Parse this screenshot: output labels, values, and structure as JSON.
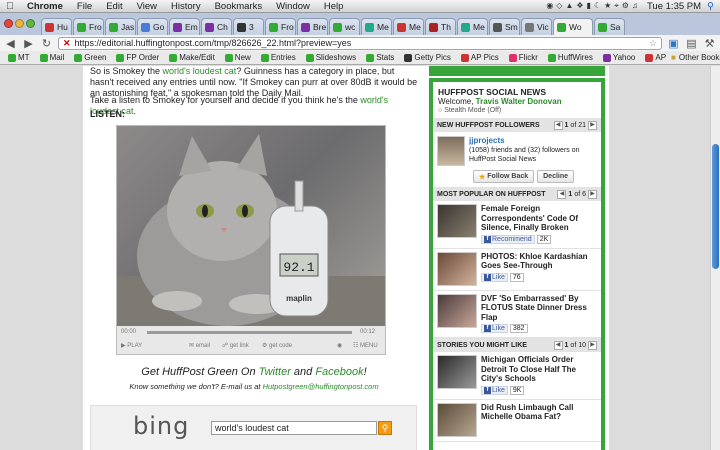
{
  "menubar": {
    "app": "Chrome",
    "items": [
      "File",
      "Edit",
      "View",
      "History",
      "Bookmarks",
      "Window",
      "Help"
    ],
    "clock": "Tue 1:35 PM"
  },
  "tabs": [
    {
      "label": "Hu",
      "icon": "gmail-icon",
      "color": "#c33"
    },
    {
      "label": "Fro",
      "icon": "green-h-icon",
      "color": "#3a3"
    },
    {
      "label": "Jas",
      "icon": "green-h-icon",
      "color": "#3a3"
    },
    {
      "label": "Go",
      "icon": "google-icon",
      "color": "#4a7cd6"
    },
    {
      "label": "Em",
      "icon": "yahoo-icon",
      "color": "#7b2fa2"
    },
    {
      "label": "Ch",
      "icon": "yahoo-icon",
      "color": "#7b2fa2"
    },
    {
      "label": "3",
      "icon": "number-icon",
      "color": "#333"
    },
    {
      "label": "Fro",
      "icon": "green-h-icon",
      "color": "#3a3"
    },
    {
      "label": "Bre",
      "icon": "yahoo-icon",
      "color": "#7b2fa2"
    },
    {
      "label": "wc",
      "icon": "green-h-icon",
      "color": "#3a3"
    },
    {
      "label": "Me",
      "icon": "green-page-icon",
      "color": "#2a8"
    },
    {
      "label": "Me",
      "icon": "red-page-icon",
      "color": "#c33"
    },
    {
      "label": "Th",
      "icon": "red-page-icon",
      "color": "#a22"
    },
    {
      "label": "Me",
      "icon": "green-page-icon",
      "color": "#2a8"
    },
    {
      "label": "Sm",
      "icon": "globe-icon",
      "color": "#555"
    },
    {
      "label": "Vic",
      "icon": "clock-icon",
      "color": "#777"
    },
    {
      "label": "Wo",
      "icon": "green-h-icon",
      "color": "#3a3",
      "active": true
    },
    {
      "label": "Sa",
      "icon": "green-h-icon",
      "color": "#3a3"
    }
  ],
  "toolbar": {
    "url": "https://editorial.huffingtonpost.com/tmp/826626_22.html?preview=yes"
  },
  "bookmarks": [
    {
      "label": "MT",
      "icon": "green-h-icon",
      "color": "#3a3"
    },
    {
      "label": "Mail",
      "icon": "green-h-icon",
      "color": "#3a3"
    },
    {
      "label": "Green",
      "icon": "green-h-icon",
      "color": "#3a3"
    },
    {
      "label": "FP Order",
      "icon": "green-h-icon",
      "color": "#3a3"
    },
    {
      "label": "Make/Edit",
      "icon": "green-h-icon",
      "color": "#3a3"
    },
    {
      "label": "New",
      "icon": "green-h-icon",
      "color": "#3a3"
    },
    {
      "label": "Entries",
      "icon": "green-h-icon",
      "color": "#3a3"
    },
    {
      "label": "Slideshows",
      "icon": "green-h-icon",
      "color": "#3a3"
    },
    {
      "label": "Stats",
      "icon": "green-h-icon",
      "color": "#3a3"
    },
    {
      "label": "Getty Pics",
      "icon": "getty-icon",
      "color": "#333"
    },
    {
      "label": "AP Pics",
      "icon": "ap-icon",
      "color": "#c33"
    },
    {
      "label": "Flickr",
      "icon": "flickr-icon",
      "color": "#e0306a"
    },
    {
      "label": "HuffWires",
      "icon": "green-h-icon",
      "color": "#3a3"
    },
    {
      "label": "Yahoo",
      "icon": "yahoo-icon",
      "color": "#7b2fa2"
    },
    {
      "label": "AP",
      "icon": "ap-icon",
      "color": "#c33"
    }
  ],
  "other_bookmarks": "Other Bookmarks",
  "article": {
    "p1_prefix": "So is Smokey the ",
    "p1_link": "world's loudest cat",
    "p1_rest": "? Guinness has a category in place, but hasn't received any entries until now. \"If Smokey can purr at over 80dB it would be an astonishing feat,\" a spokesman told the Daily Mail.",
    "p2_prefix": "Take a listen to Smokey for yourself and decide if you think he's the ",
    "p2_link": "world's loudest cat",
    "p2_suffix": ".",
    "listen": "LISTEN:",
    "meter_reading": "92.1",
    "meter_brand": "maplin",
    "player": {
      "time_start": "00:00",
      "time_end": "00:12",
      "play": "PLAY",
      "email": "email",
      "get_link": "get link",
      "get_code": "get code",
      "menu": "MENU"
    },
    "green_prefix": "Get HuffPost Green On ",
    "green_twitter": "Twitter",
    "green_and": " and ",
    "green_facebook": "Facebook",
    "green_suffix": "!",
    "know_prefix": "Know something we don't? E-mail us at ",
    "know_email": "Hutpostgreen@huffingtonpost.com"
  },
  "bing": {
    "logo": "bing",
    "query": "world's loudest cat"
  },
  "social": {
    "title": "HUFFPOST SOCIAL NEWS",
    "welcome_prefix": "Welcome, ",
    "user": "Travis Walter Donovan",
    "stealth": "Stealth Mode (Off)",
    "followers_head": "NEW HUFFPOST FOLLOWERS",
    "followers_page": "1",
    "followers_total": "of 21",
    "follower_name": "jjprojects",
    "follower_stats": "(1058) friends and (32) followers on HuffPost Social News",
    "follow_back": "Follow Back",
    "decline": "Decline",
    "popular_head": "MOST POPULAR ON HUFFPOST",
    "popular_page": "1",
    "popular_total": "of 6",
    "popular": [
      {
        "title": "Female Foreign Correspondents' Code Of Silence, Finally Broken",
        "action": "Recommend",
        "count": "2K"
      },
      {
        "title": "PHOTOS: Khloe Kardashian Goes See-Through",
        "action": "Like",
        "count": "76"
      },
      {
        "title": "DVF 'So Embarrassed' By FLOTUS State Dinner Dress Flap",
        "action": "Like",
        "count": "382"
      }
    ],
    "like_head": "STORIES YOU MIGHT LIKE",
    "like_page": "1",
    "like_total": "of 10",
    "stories": [
      {
        "title": "Michigan Officials Order Detroit To Close Half The City's Schools",
        "action": "Like",
        "count": "9K"
      },
      {
        "title": "Did Rush Limbaugh Call Michelle Obama Fat?",
        "action": "",
        "count": ""
      }
    ]
  },
  "colors": {
    "huff_green": "#38a53a",
    "link_green": "#2a8a2a",
    "facebook_blue": "#3b5998",
    "bing_orange": "#f39c12"
  }
}
